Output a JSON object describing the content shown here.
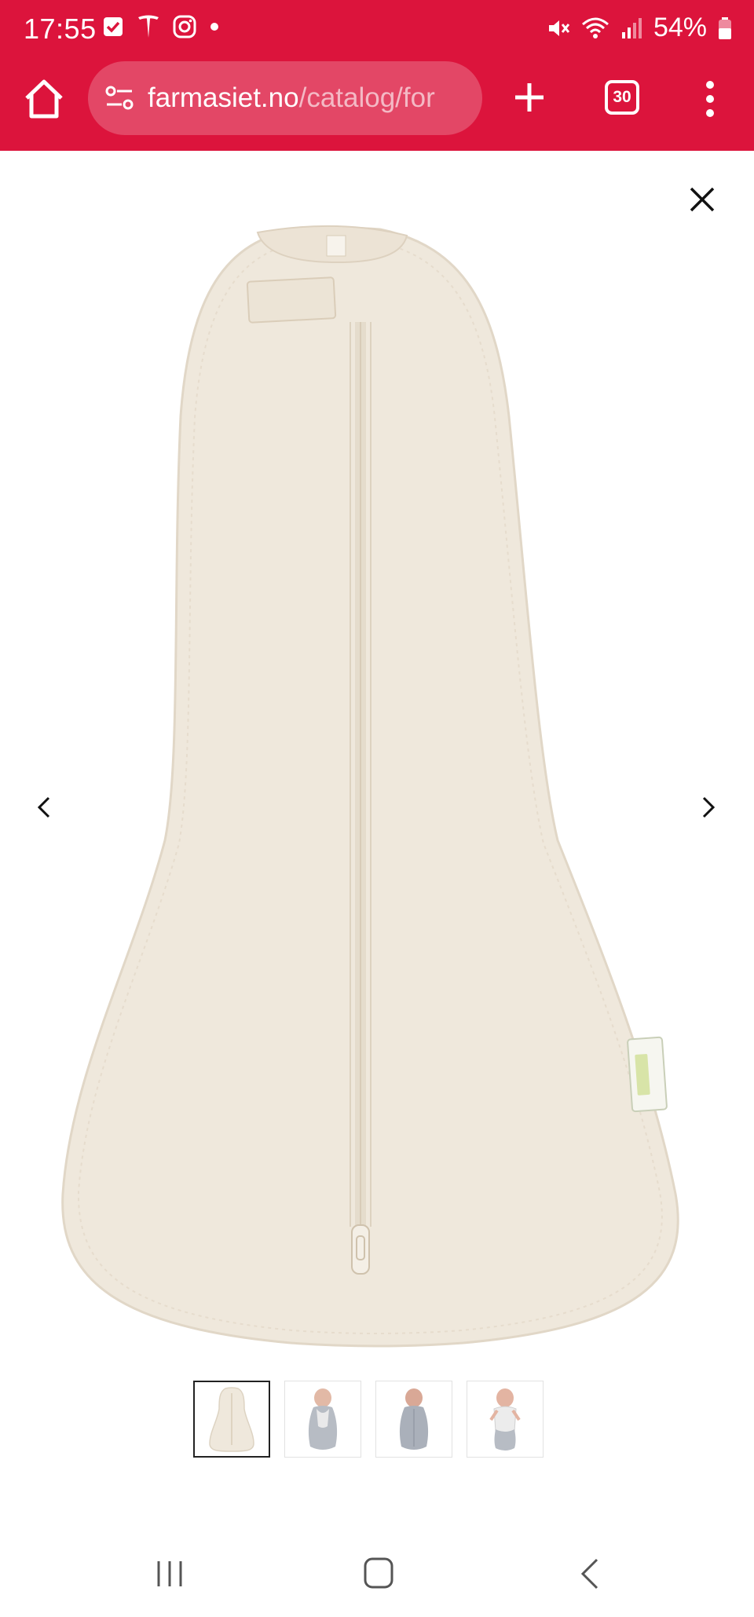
{
  "status_bar": {
    "time": "17:55",
    "battery": "54%",
    "left_icons": [
      "checkbox-icon",
      "tesla-icon",
      "instagram-icon",
      "dot-icon"
    ],
    "right_icons": [
      "mute-icon",
      "wifi-icon",
      "signal-icon",
      "battery-icon"
    ]
  },
  "browser": {
    "url_domain": "farmasiet.no",
    "url_path": "/catalog/for",
    "tab_count": "30",
    "accent_color": "#dc143c"
  },
  "viewer": {
    "product_image_icon": "swaddle-sleep-sack",
    "thumbnails": [
      {
        "icon": "swaddle-cream-thumbnail",
        "active": true
      },
      {
        "icon": "baby-in-grey-swaddle-thumbnail",
        "active": false
      },
      {
        "icon": "baby-in-grey-swaddle-thumbnail",
        "active": false
      },
      {
        "icon": "baby-in-white-swaddle-thumbnail",
        "active": false
      }
    ]
  },
  "nav_bar": {
    "icons": [
      "recents-icon",
      "home-icon",
      "back-icon"
    ]
  }
}
